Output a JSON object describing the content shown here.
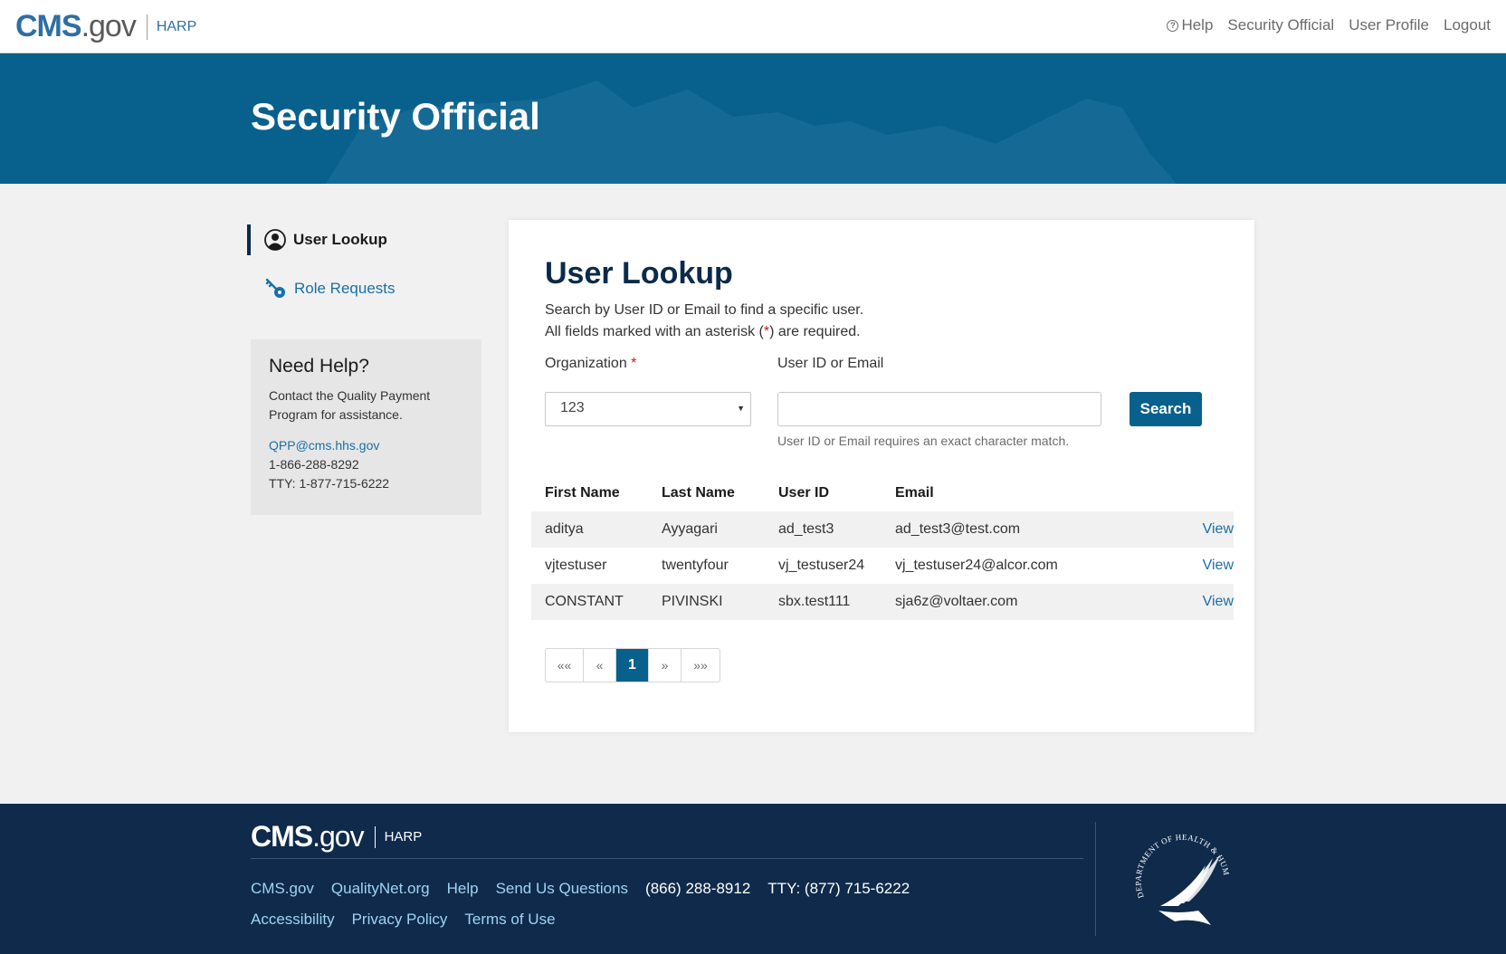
{
  "header": {
    "brand_main": "CMS",
    "brand_gov": ".gov",
    "brand_app": "HARP",
    "nav": [
      {
        "label": "Help",
        "icon": "help-circle-icon"
      },
      {
        "label": "Security Official"
      },
      {
        "label": "User Profile"
      },
      {
        "label": "Logout"
      }
    ]
  },
  "hero": {
    "title": "Security Official"
  },
  "sidebar": {
    "items": [
      {
        "label": "User Lookup",
        "icon": "user-circle-icon",
        "active": true
      },
      {
        "label": "Role Requests",
        "icon": "key-icon",
        "active": false
      }
    ],
    "help": {
      "title": "Need Help?",
      "text": "Contact the Quality Payment Program for assistance.",
      "email": "QPP@cms.hhs.gov",
      "phone": "1-866-288-8292",
      "tty": "TTY: 1-877-715-6222"
    }
  },
  "main": {
    "title": "User Lookup",
    "desc1": "Search by User ID or Email to find a specific user.",
    "desc2_pre": "All fields marked with an asterisk (",
    "desc2_star": "*",
    "desc2_post": ") are required.",
    "org_label": "Organization",
    "org_required": "*",
    "org_value": "123",
    "userid_label": "User ID or Email",
    "userid_value": "",
    "userid_hint": "User ID or Email requires an exact character match.",
    "search_label": "Search",
    "columns": [
      "First Name",
      "Last Name",
      "User ID",
      "Email"
    ],
    "rows": [
      {
        "first": "aditya",
        "last": "Ayyagari",
        "userid": "ad_test3",
        "email": "ad_test3@test.com",
        "action": "View"
      },
      {
        "first": "vjtestuser",
        "last": "twentyfour",
        "userid": "vj_testuser24",
        "email": "vj_testuser24@alcor.com",
        "action": "View"
      },
      {
        "first": "CONSTANT",
        "last": "PIVINSKI",
        "userid": "sbx.test111",
        "email": "sja6z@voltaer.com",
        "action": "View"
      }
    ],
    "pagination": {
      "first": "««",
      "prev": "«",
      "current": "1",
      "next": "»",
      "last": "»»"
    }
  },
  "footer": {
    "brand_main": "CMS",
    "brand_gov": ".gov",
    "brand_app": "HARP",
    "links": [
      "CMS.gov",
      "QualityNet.org",
      "Help",
      "Send Us Questions"
    ],
    "phone": "(866) 288-8912",
    "tty": "TTY: (877) 715-6222",
    "links2": [
      "Accessibility",
      "Privacy Policy",
      "Terms of Use"
    ]
  },
  "colors": {
    "primary": "#08608c",
    "navy": "#0f2a4a",
    "link": "#1a6fa8",
    "required": "#c8161d"
  }
}
